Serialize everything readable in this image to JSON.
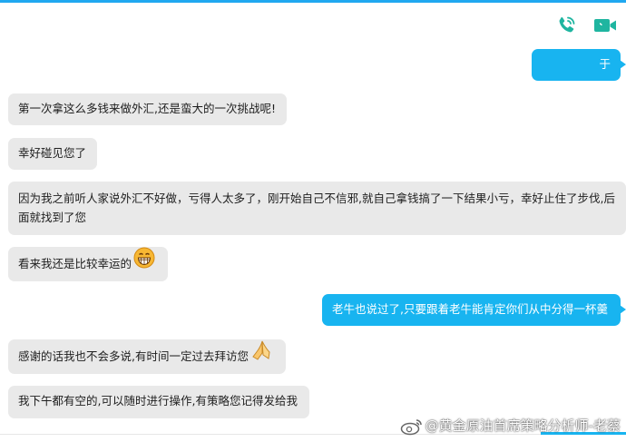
{
  "header": {
    "voice_call_icon": "phone-icon",
    "video_call_icon": "video-camera-icon",
    "accent_color": "#1fb5a0"
  },
  "messages": [
    {
      "side": "right",
      "text": "于"
    },
    {
      "side": "left",
      "text": "第一次拿这么多钱来做外汇,还是蛮大的一次挑战呢!"
    },
    {
      "side": "left",
      "text": "幸好碰见您了"
    },
    {
      "side": "left",
      "text": "因为我之前听人家说外汇不好做，亏得人太多了，刚开始自己不信邪,就自己拿钱搞了一下结果小亏，幸好止住了步伐,后面就找到了您"
    },
    {
      "side": "left",
      "text": "看来我还是比较幸运的"
    },
    {
      "side": "right",
      "text": "老牛也说过了,只要跟着老牛能肯定你们从中分得一杯羹"
    },
    {
      "side": "left",
      "text": "感谢的话我也不会多说,有时间一定过去拜访您"
    },
    {
      "side": "left",
      "text": "我下午都有空的,可以随时进行操作,有策略您记得发给我"
    }
  ],
  "watermark": {
    "text": "@黄金原油首席策略分析师-老蔡"
  },
  "colors": {
    "left_bubble": "#e9e9e9",
    "right_bubble": "#18b4f0",
    "top_bar": "#20a8f0"
  }
}
